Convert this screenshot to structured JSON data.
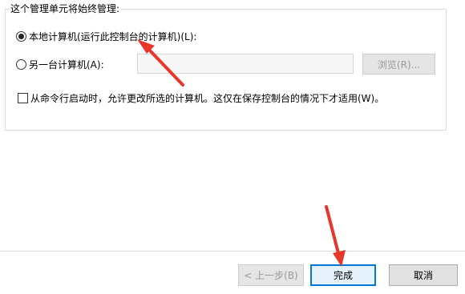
{
  "group": {
    "title": "这个管理单元将始终管理:"
  },
  "options": {
    "local": {
      "label": "本地计算机(运行此控制台的计算机)(L):",
      "checked": true
    },
    "remote": {
      "label": "另一台计算机(A):",
      "checked": false
    }
  },
  "remote_input": {
    "value": ""
  },
  "browse_button": {
    "label": "浏览(R)..."
  },
  "allow_change": {
    "label": "从命令行启动时，允许更改所选的计算机。这仅在保存控制台的情况下才适用(W)。",
    "checked": false
  },
  "footer": {
    "back_label": "< 上一步(B)",
    "finish_label": "完成",
    "cancel_label": "取消"
  },
  "colors": {
    "annotation_arrow": "#e8362a",
    "default_button_border": "#0078d7"
  }
}
